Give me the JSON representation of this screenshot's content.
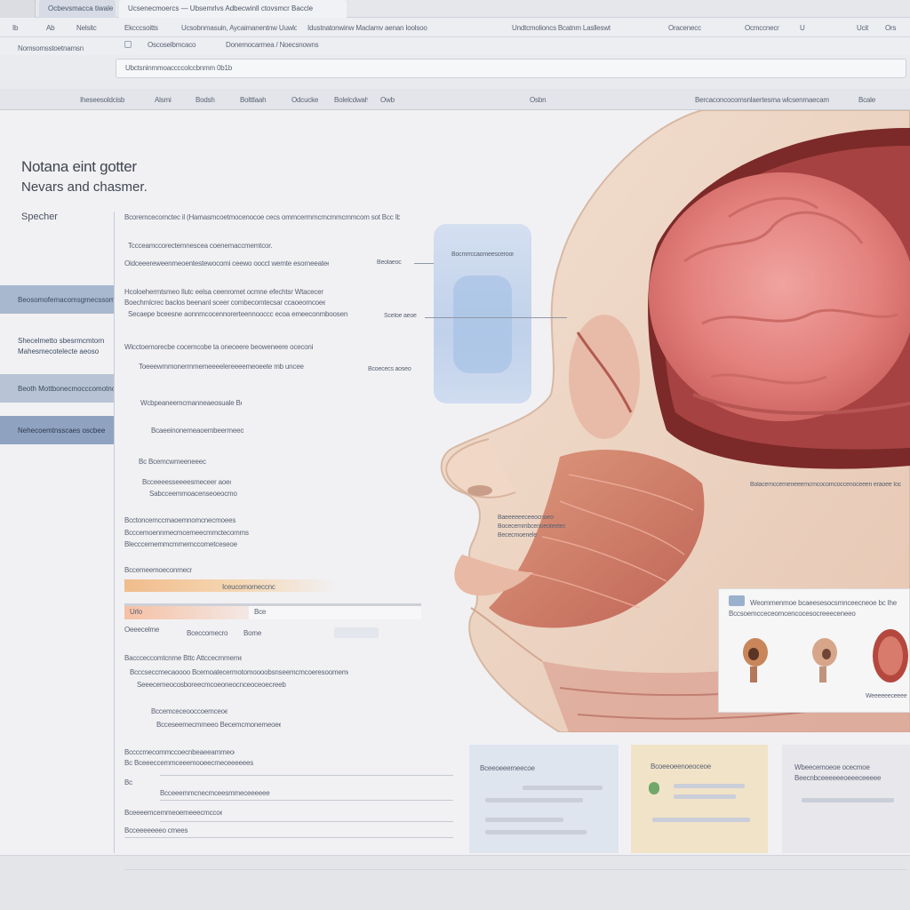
{
  "browser": {
    "tabs": [
      "Ocbevsmacca tiwale",
      "Ucsenecmoercs — Ubsemrlvs Adbecwinll ctovsmcr Baccle"
    ],
    "nav": [
      "Ib",
      "Ab",
      "Nelsitc",
      "Ekcccsoitts",
      "Ucsobnmasuin, Aycaimanentnw Uuwlo",
      "Idustnatonwinw Maclamv aenan Ioolsoo",
      "Undtcmolioncs Bcatnm Laslleswt",
      "Oracenecc",
      "Ocmccnecr",
      "U",
      "Ucit",
      "Ors"
    ],
    "bookmark_row": [
      "Oscoselbmcaco",
      "Donemocarmea / Noecsnowns",
      "Nomsomsstoetnamsn"
    ],
    "address": "Ubctsninmmoaccccolccbnmm 0b1b",
    "menu": [
      "Iheseesoldcisb",
      "Alsmi",
      "Bodsh",
      "Bolttlaah",
      "Odcucke",
      "Bolelcdwah",
      "Owb",
      "Osbn",
      "Bercaconcocomsnlaertesma wlcsenmaecam",
      "Bcale"
    ]
  },
  "page": {
    "title": "Notana eint gotter",
    "subtitle": "Nevars and chasmer.",
    "section_label": "Specher"
  },
  "sidebar": [
    "Beosomofemacomsgmecssom",
    "Shecelmetto sbesrmcmtorn\nMahesmecotelecte aeoso",
    "Beoth Mottbonecmocccomotnoe",
    "Nehecoemtnsscaes oscbee"
  ],
  "content_lines": [
    "Bcoremcecomctec il (Hamasmcoetmocenocoe cecs ommcermmcmcmmcmmcom sot Bcc Ibetel Itecocm",
    "Tccceamccorectemnescea coenemaccmemtcor.",
    "Oidceeereweenmeoentestewocomi ceewo oocct wemte esorneeatee",
    "Hcoloehermtsmeo Ilutc eelsa ceenromet ocmne efechtsr Wtacecer",
    "Boechmlcrec baclos beenanl sceer combecomtecsar ccaoeomcoeeb",
    "Secaepe bceesne aonnmcocennorerteennooccc ecoa emeeconmboosen",
    "Wicctoemorecbe cocemcobe ta oneceere beoweneere oceconi",
    "Toeeewmmonermmemeeeelereeeemeoeete mb uncee",
    "Wcbpeaneemcmanneaeosuale Boco",
    "Bcaeeinonemeaoembeermeeon. abcs",
    "Bc Bcemcwmeeneeecoe",
    "Bcceeeesseeeesmeceer aoecs",
    "Sabcceemmoacenseoeocmo esla",
    "Bcctoncemccmaoemnomcnecmoees",
    "Bcccemoennmecmcemeecmmctecommsecm",
    "Blecccememmcmmemccometceseoe",
    "Bccemeemoeconmecme Blocmenema"
  ],
  "form_labels": [
    "Iceucomorneccncoce",
    "Urlo",
    "Bce",
    "Oeeecelme",
    "Bceccomecro",
    "Bome"
  ],
  "lower_lines": [
    "Baccceccomtcnme Bttc Attccecmmemessetre",
    "Bcccseccmecaoooo Bcemoatecermotomoooobsnseemcmcoeresoomemes",
    "Seeecemeocosboreecmcoeoneocnceoceoecreeb",
    "Bccemceceooccoemceoecs",
    "Bcceseemecmmeeo Becemcmonemeoeecnmemeeemoeeee",
    "Bccccmecommccoecnbeaeeammeoemene",
    "Bc Bceeeccemmceeemooeecmeceeeeees",
    "Bc",
    "Bcceeemmcnecmceesmmeceeeeee",
    "Bceeeemcemmeoemeeecmccoeeeeere",
    "Bcceeeeeeeo cmees"
  ],
  "callouts": [
    "Bocmrrccaomeesceroomcoconio",
    "Beolaeoc",
    "Sceloe aeoe",
    "Bcoececs aoseo",
    "Bolacemccemeneeemcmcocomcoccenoceeen eraoee Ioc",
    "Baeeeeeeceeocnoeo\nBocecemmbcenoeoteetes\nBececmoenele"
  ],
  "info_card": {
    "title": "Weommenmoe bcaeesesocsmnceecneoe bc Ihe",
    "subtitle": "Bccsoemcceceomcencocesocreeeceneeo",
    "thumb_caption": "Weeeeeeceeee"
  },
  "bottom_cards": [
    {
      "title": "Bceeoeeemeecoe"
    },
    {
      "title": "Bcoeeoeenoeoceoe"
    },
    {
      "title": "Wbeecemoeoe ocecmoe Beecnbceeeeeeoeeeceeeee"
    }
  ],
  "colors": {
    "accent_blue": "#a8b8cf",
    "accent_blue_dark": "#8fa3c0",
    "tissue_pink": "#e58a86",
    "skin": "#edd7c6"
  }
}
